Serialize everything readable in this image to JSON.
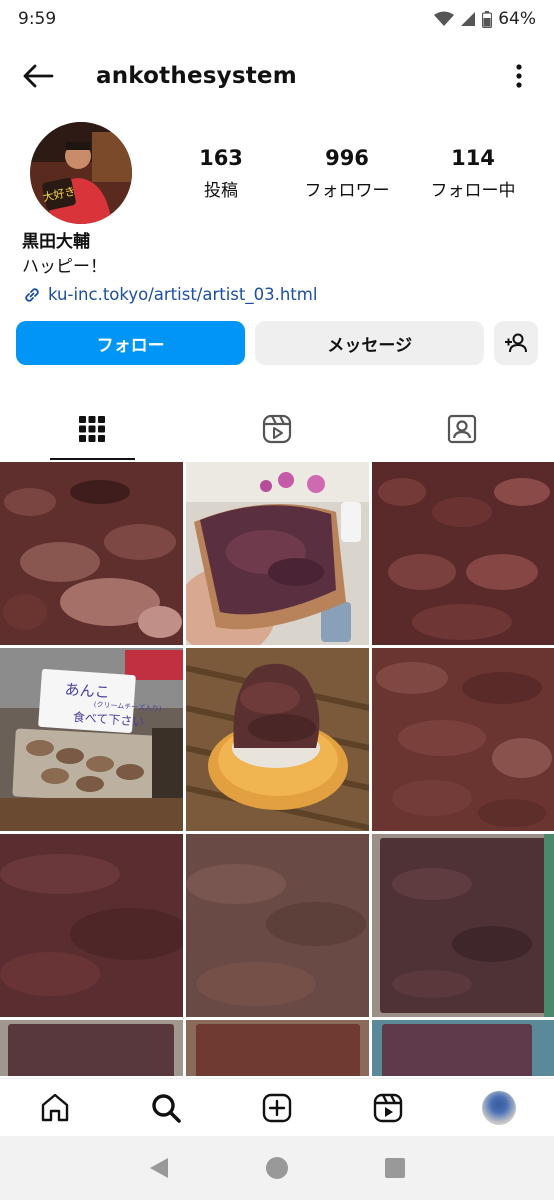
{
  "status": {
    "time": "9:59",
    "battery": "64%"
  },
  "header": {
    "username": "ankothesystem"
  },
  "profile": {
    "stats": [
      {
        "value": "163",
        "label": "投稿"
      },
      {
        "value": "996",
        "label": "フォロワー"
      },
      {
        "value": "114",
        "label": "フォロー中"
      }
    ],
    "name": "黒田大輔",
    "bio": "ハッピー！",
    "link": "ku-inc.tokyo/artist/artist_03.html",
    "avatar_sign_text": "大好き"
  },
  "actions": {
    "follow": "フォロー",
    "message": "メッセージ"
  },
  "tabs": [
    "grid-icon",
    "reels-icon",
    "tagged-icon"
  ],
  "posts": [
    {
      "image": "red-bean-paste-closeup",
      "caption": ""
    },
    {
      "image": "red-bean-paste-on-toast",
      "caption": ""
    },
    {
      "image": "red-bean-paste-closeup",
      "caption": ""
    },
    {
      "image": "bean-paste-sign-and-tray",
      "caption": "あんこ\n(クリームチーズ入り)\n食べて下さい"
    },
    {
      "image": "bean-paste-on-cracker",
      "caption": ""
    },
    {
      "image": "red-bean-paste-closeup",
      "caption": ""
    },
    {
      "image": "red-bean-paste-smooth",
      "caption": ""
    },
    {
      "image": "red-bean-paste-smooth",
      "caption": ""
    },
    {
      "image": "red-bean-paste-tray",
      "caption": ""
    },
    {
      "image": "red-bean-paste-tray",
      "caption": ""
    },
    {
      "image": "red-bean-paste-tray",
      "caption": ""
    },
    {
      "image": "red-bean-paste-tray",
      "caption": ""
    }
  ],
  "bottom_nav": [
    "home-icon",
    "search-icon",
    "create-icon",
    "reels-icon",
    "profile-avatar"
  ],
  "system_nav": [
    "back-triangle",
    "home-circle",
    "recents-square"
  ]
}
